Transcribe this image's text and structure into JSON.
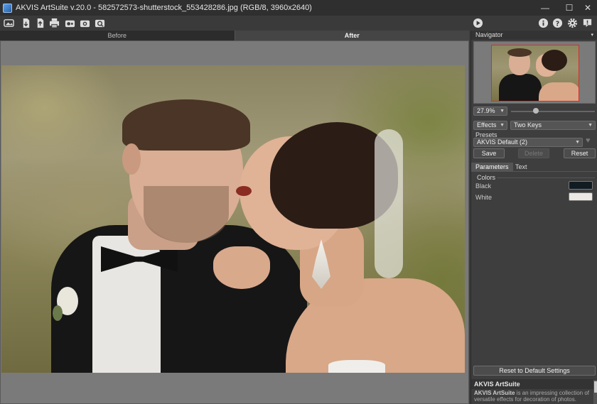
{
  "window": {
    "title": "AKVIS ArtSuite v.20.0 - 582572573-shutterstock_553428286.jpg (RGB/8, 3960x2640)",
    "min_glyph": "—",
    "max_glyph": "☐",
    "close_glyph": "✕"
  },
  "toolbar": {
    "left_icons": [
      "open-image-icon",
      "save-icon",
      "export-icon",
      "print-icon",
      "batch-icon",
      "share-icon",
      "zoom-icon"
    ],
    "right_icons": [
      "info-icon",
      "help-icon",
      "settings-icon",
      "notification-icon"
    ],
    "run_icon": "play-icon"
  },
  "view_tabs": {
    "before": "Before",
    "after": "After",
    "active": "after"
  },
  "navigator": {
    "title": "Navigator",
    "zoom": "27.9%",
    "zoom_slider_fraction": 0.3
  },
  "effects": {
    "group": "Effects",
    "effect": "Two Keys"
  },
  "presets": {
    "label": "Presets",
    "selected": "AKVIS Default (2)",
    "save": "Save",
    "delete": "Delete",
    "reset": "Reset"
  },
  "param_tabs": {
    "parameters": "Parameters",
    "text": "Text",
    "active": "parameters"
  },
  "colors": {
    "label": "Colors",
    "black_label": "Black",
    "black_value": "#101c22",
    "white_label": "White",
    "white_value": "#ece8e4"
  },
  "reset_default": "Reset to Default Settings",
  "info": {
    "title": "AKVIS ArtSuite",
    "body_bold": "AKVIS ArtSuite",
    "body_rest": " is an impressing collection of versatile effects for decoration of photos."
  }
}
